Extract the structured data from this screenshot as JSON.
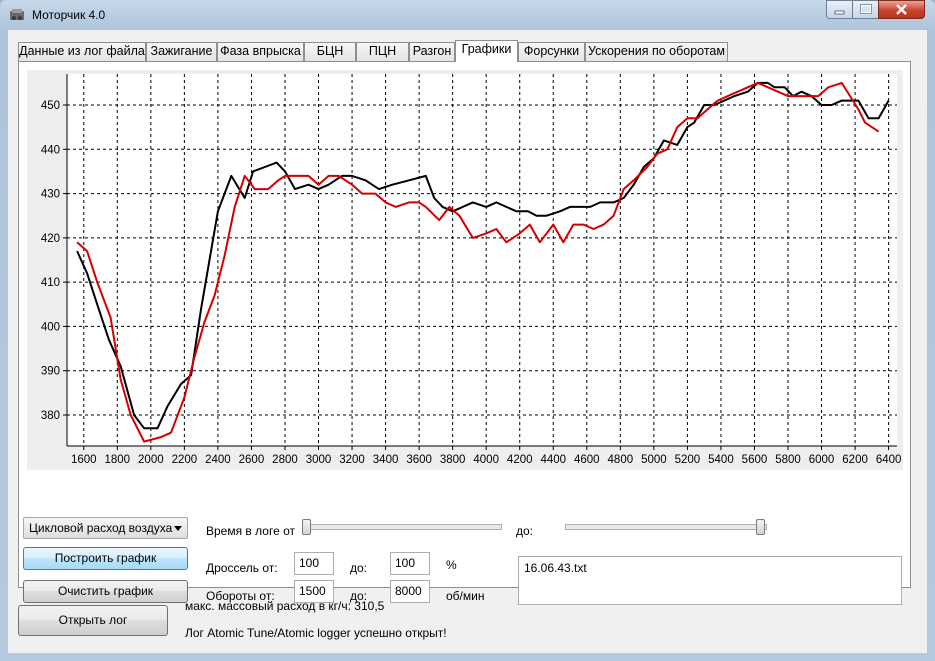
{
  "window": {
    "title": "Моторчик 4.0"
  },
  "tabs": [
    {
      "label": "Данные из лог файла"
    },
    {
      "label": "Зажигание"
    },
    {
      "label": "Фаза впрыска"
    },
    {
      "label": "БЦН"
    },
    {
      "label": "ПЦН"
    },
    {
      "label": "Разгон"
    },
    {
      "label": "Графики"
    },
    {
      "label": "Форсунки"
    },
    {
      "label": "Ускорения по оборотам"
    }
  ],
  "active_tab": "Графики",
  "controls": {
    "param_select": "Цикловой расход воздуха",
    "build_button": "Построить график",
    "clear_button": "Очистить график",
    "time_from_label": "Время в логе от",
    "time_to_label": "до:",
    "throttle_label": "Дроссель от:",
    "throttle_from": "100",
    "throttle_to_label": "до:",
    "throttle_to": "100",
    "throttle_unit": "%",
    "rpm_label": "Обороты от:",
    "rpm_from": "1500",
    "rpm_to_label": "до:",
    "rpm_to": "8000",
    "rpm_unit": "об/мин",
    "file_list": "16.06.43.txt"
  },
  "bottom": {
    "open_button": "Открыть лог",
    "max_flow": "макс. массовый расход в кг/ч: 310,5",
    "status": "Лог Atomic Tune/Atomic logger успешно открыт!"
  },
  "colors": {
    "series_black": "#000000",
    "series_red": "#d40000",
    "grid": "#000000",
    "plot_bg": "#ffffff",
    "frame_bg": "#eeeeee"
  },
  "chart_data": {
    "type": "line",
    "xlim": [
      1500,
      6450
    ],
    "ylim": [
      373,
      457
    ],
    "xticks": [
      1600,
      1800,
      2000,
      2200,
      2400,
      2600,
      2800,
      3000,
      3200,
      3400,
      3600,
      3800,
      4000,
      4200,
      4400,
      4600,
      4800,
      5000,
      5200,
      5400,
      5600,
      5800,
      6000,
      6200,
      6400
    ],
    "yticks": [
      380,
      390,
      400,
      410,
      420,
      430,
      440,
      450
    ],
    "grid": true,
    "series": [
      {
        "color": "#000000",
        "x": [
          1560,
          1620,
          1680,
          1750,
          1820,
          1900,
          1960,
          2040,
          2100,
          2180,
          2240,
          2300,
          2400,
          2480,
          2560,
          2610,
          2680,
          2750,
          2800,
          2860,
          2940,
          3000,
          3060,
          3140,
          3200,
          3280,
          3360,
          3440,
          3540,
          3640,
          3690,
          3740,
          3800,
          3860,
          3920,
          4000,
          4060,
          4120,
          4180,
          4250,
          4300,
          4360,
          4440,
          4500,
          4560,
          4620,
          4680,
          4760,
          4820,
          4880,
          4940,
          5000,
          5060,
          5140,
          5200,
          5240,
          5300,
          5360,
          5420,
          5480,
          5560,
          5620,
          5680,
          5720,
          5780,
          5830,
          5880,
          5940,
          6000,
          6060,
          6120,
          6170,
          6220,
          6280,
          6340,
          6400
        ],
        "y": [
          417,
          412,
          405,
          397,
          391,
          380,
          377,
          377,
          382,
          387,
          389,
          404,
          426,
          434,
          429,
          435,
          436,
          437,
          435,
          431,
          432,
          431,
          432,
          434,
          434,
          433,
          431,
          432,
          433,
          434,
          429,
          427,
          426,
          427,
          428,
          427,
          428,
          427,
          426,
          426,
          425,
          425,
          426,
          427,
          427,
          427,
          428,
          428,
          429,
          432,
          436,
          438,
          442,
          441,
          445,
          446,
          450,
          450,
          451,
          452,
          453,
          455,
          455,
          454,
          454,
          452,
          453,
          452,
          450,
          450,
          451,
          451,
          451,
          447,
          447,
          451
        ]
      },
      {
        "color": "#d40000",
        "x": [
          1560,
          1620,
          1680,
          1760,
          1820,
          1880,
          1960,
          2060,
          2120,
          2200,
          2260,
          2320,
          2380,
          2440,
          2500,
          2560,
          2620,
          2700,
          2760,
          2800,
          2860,
          2940,
          3000,
          3060,
          3120,
          3200,
          3260,
          3340,
          3400,
          3460,
          3540,
          3600,
          3640,
          3720,
          3780,
          3840,
          3920,
          4000,
          4060,
          4120,
          4200,
          4260,
          4320,
          4400,
          4460,
          4520,
          4580,
          4640,
          4700,
          4760,
          4820,
          4880,
          4960,
          5020,
          5080,
          5140,
          5200,
          5260,
          5320,
          5380,
          5440,
          5500,
          5560,
          5620,
          5680,
          5740,
          5800,
          5860,
          5920,
          5980,
          6040,
          6120,
          6170,
          6220,
          6260,
          6300,
          6340
        ],
        "y": [
          419,
          417,
          410,
          402,
          388,
          380,
          374,
          375,
          376,
          384,
          393,
          401,
          407,
          416,
          427,
          434,
          431,
          431,
          433,
          434,
          434,
          434,
          432,
          434,
          434,
          432,
          430,
          430,
          428,
          427,
          428,
          428,
          427,
          424,
          427,
          425,
          420,
          421,
          422,
          419,
          421,
          423,
          419,
          423,
          419,
          423,
          423,
          422,
          423,
          425,
          431,
          433,
          436,
          439,
          440,
          445,
          447,
          447,
          449,
          451,
          452,
          453,
          454,
          455,
          454,
          453,
          452,
          452,
          452,
          452,
          454,
          455,
          452,
          449,
          446,
          445,
          444
        ]
      }
    ]
  }
}
